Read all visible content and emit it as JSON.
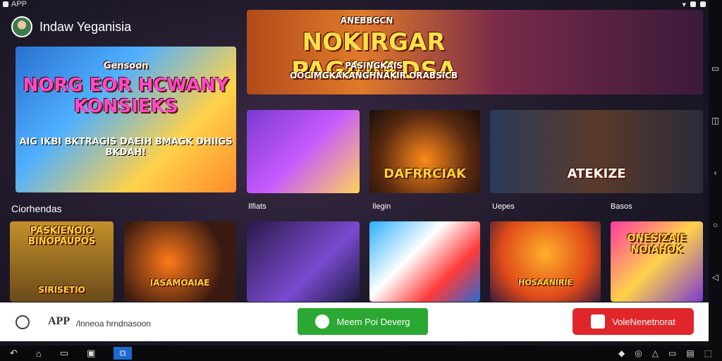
{
  "statusbar": {
    "label": "APP"
  },
  "header": {
    "title": "Indaw Yeganisia"
  },
  "top_icons": {
    "link": "⛓",
    "search": "⌕",
    "more": "⋮"
  },
  "hero_left": {
    "line1": "Gensoon",
    "line2": "NORG EOR HCWANY KONSIEKS",
    "line3": "AIG IKBI BKTRAGIS DAEIH BMAGK DHIIGS BKDAH!"
  },
  "hero_right": {
    "line1": "ANEBBGCN",
    "line2": "NOKIRGAR PAGAARDSA",
    "line3": "PASINGKAIS OOCIMGKAKANGHNAKIR ORABSICB"
  },
  "cards_row1": {
    "b_label": "DAFRRCIAK",
    "c_label": "ATEKIZE"
  },
  "section": {
    "title": "Ciorhendas"
  },
  "tags": [
    "Ilfiats",
    "Ilegin",
    "Uepes",
    "Basos"
  ],
  "cards_row2": {
    "a_top": "PASKIENOIO BINOPAUPOS",
    "a_bottom": "SIRISETIO",
    "b_label": "IASAMOAIAE",
    "e_label": "HOSAANIRIE",
    "f_label": "ONESIZAIE NOIAHOK"
  },
  "bottombar": {
    "brand": "APP",
    "text": "/lnneoa hrndnasoon",
    "green_btn": "Meem Poi Deverg",
    "red_btn": "VoleNenetnorat"
  },
  "rail": [
    "▭",
    "◫",
    "‹",
    "○",
    "◁"
  ],
  "navbar": {
    "back": "↶",
    "home": "⌂",
    "recent": "▭",
    "gallery": "▣",
    "active": "⧉",
    "tray": [
      "◆",
      "◎",
      "△",
      "▭",
      "▤",
      "⬚"
    ]
  }
}
